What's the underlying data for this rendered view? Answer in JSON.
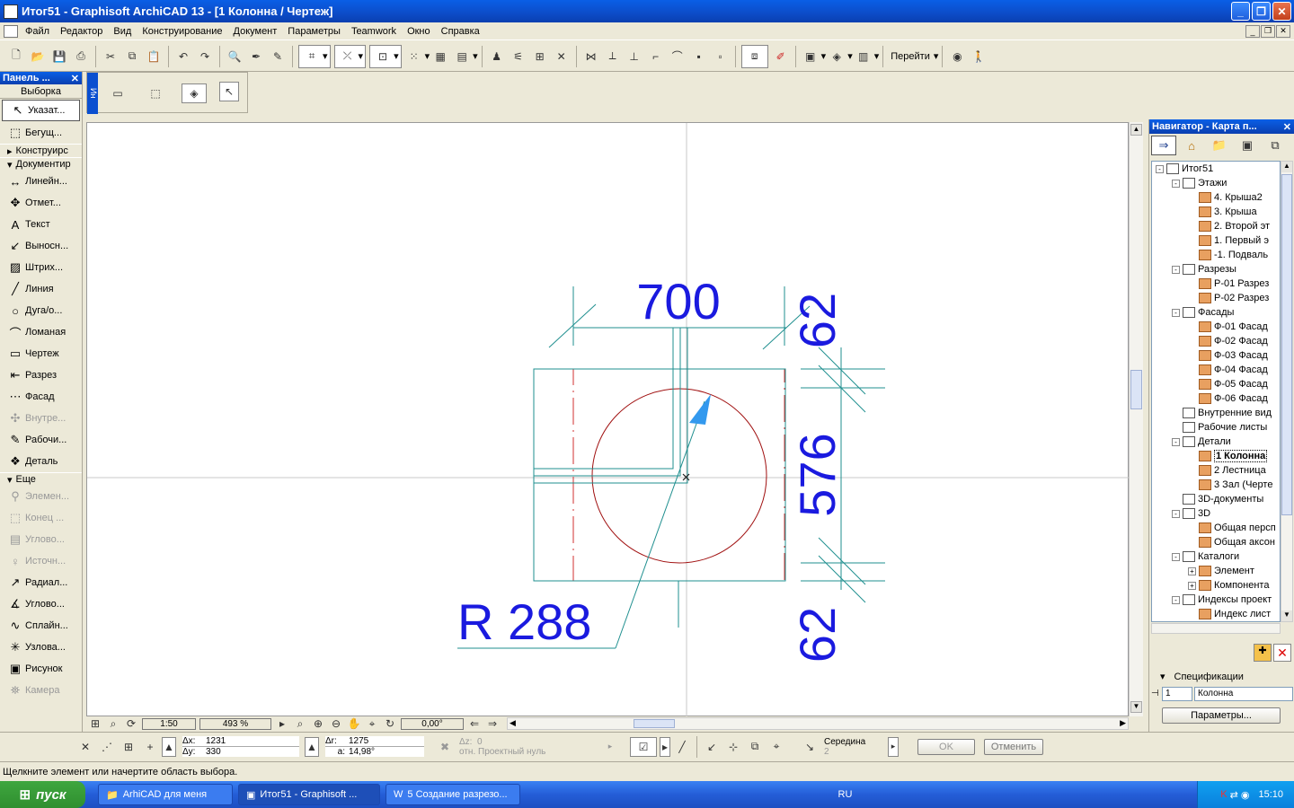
{
  "window": {
    "title": "Итог51 - Graphisoft ArchiCAD 13 - [1 Колонна / Чертеж]"
  },
  "menu": [
    "Файл",
    "Редактор",
    "Вид",
    "Конструирование",
    "Документ",
    "Параметры",
    "Teamwork",
    "Окно",
    "Справка"
  ],
  "toolbar": {
    "goto_label": "Перейти"
  },
  "infobox": {
    "label": "Ин"
  },
  "toolbox": {
    "title": "Панель ...",
    "select_header": "Выборка",
    "select_tools": [
      {
        "label": "Указат...",
        "icon": "arrow-pointer-icon",
        "glyph": "↖"
      },
      {
        "label": "Бегущ...",
        "icon": "marquee-icon",
        "glyph": "⬚"
      }
    ],
    "group_construct": "Конструирс",
    "group_document": "Документир",
    "doc_tools": [
      {
        "label": "Линейн...",
        "icon": "linear-dimension-icon",
        "glyph": "↔",
        "disabled": false
      },
      {
        "label": "Отмет...",
        "icon": "level-dimension-icon",
        "glyph": "✥",
        "disabled": false
      },
      {
        "label": "Текст",
        "icon": "text-icon",
        "glyph": "A",
        "disabled": false
      },
      {
        "label": "Выносн...",
        "icon": "label-icon",
        "glyph": "↙",
        "disabled": false
      },
      {
        "label": "Штрих...",
        "icon": "fill-icon",
        "glyph": "▨",
        "disabled": false
      },
      {
        "label": "Линия",
        "icon": "line-icon",
        "glyph": "╱",
        "disabled": false
      },
      {
        "label": "Дуга/о...",
        "icon": "arc-circle-icon",
        "glyph": "○",
        "disabled": false
      },
      {
        "label": "Ломаная",
        "icon": "polyline-icon",
        "glyph": "⌒",
        "disabled": false
      },
      {
        "label": "Чертеж",
        "icon": "drawing-icon",
        "glyph": "▭",
        "disabled": false
      },
      {
        "label": "Разрез",
        "icon": "section-icon",
        "glyph": "⇤",
        "disabled": false
      },
      {
        "label": "Фасад",
        "icon": "elevation-icon",
        "glyph": "⋯",
        "disabled": false
      },
      {
        "label": "Внутре...",
        "icon": "interior-elevation-icon",
        "glyph": "✣",
        "disabled": true
      },
      {
        "label": "Рабочи...",
        "icon": "worksheet-icon",
        "glyph": "✎",
        "disabled": false
      },
      {
        "label": "Деталь",
        "icon": "detail-icon",
        "glyph": "❖",
        "disabled": false
      }
    ],
    "group_more": "Еще",
    "more_tools": [
      {
        "label": "Элемен...",
        "icon": "element-icon",
        "glyph": "⚲",
        "disabled": true
      },
      {
        "label": "Конец ...",
        "icon": "end-icon",
        "glyph": "⬚",
        "disabled": true
      },
      {
        "label": "Углово...",
        "icon": "corner-icon",
        "glyph": "▤",
        "disabled": true
      },
      {
        "label": "Источн...",
        "icon": "light-source-icon",
        "glyph": "♀",
        "disabled": true
      },
      {
        "label": "Радиал...",
        "icon": "radial-dimension-icon",
        "glyph": "↗",
        "disabled": false
      },
      {
        "label": "Углово...",
        "icon": "angle-dimension-icon",
        "glyph": "∡",
        "disabled": false
      },
      {
        "label": "Сплайн...",
        "icon": "spline-icon",
        "glyph": "∿",
        "disabled": false
      },
      {
        "label": "Узлова...",
        "icon": "hotspot-icon",
        "glyph": "✳",
        "disabled": false
      },
      {
        "label": "Рисунок",
        "icon": "figure-icon",
        "glyph": "▣",
        "disabled": false
      },
      {
        "label": "Камера",
        "icon": "camera-icon",
        "glyph": "⛯",
        "disabled": true
      }
    ]
  },
  "drawing": {
    "dim_top": "700",
    "dim_right_top": "62",
    "dim_right_middle": "576",
    "dim_right_bottom": "62",
    "radius_label": "R 288"
  },
  "viewbar": {
    "scale": "1:50",
    "zoom": "493 %",
    "angle": "0,00°"
  },
  "coords": {
    "dx_label": "Δx:",
    "dx": "1231",
    "dy_label": "Δy:",
    "dy": "330",
    "dr_label": "Δr:",
    "dr": "1275",
    "da_label": "a:",
    "da": "14,98°",
    "dz_label": "Δz:",
    "dz": "0",
    "ref_label": "отн. Проектный нуль",
    "snap_label": "Середина",
    "snap_value": "2",
    "ok": "OK",
    "cancel": "Отменить"
  },
  "status": {
    "text": "Щелкните элемент или начертите область выбора."
  },
  "navigator": {
    "title": "Навигатор - Карта п...",
    "tree": [
      {
        "label": "Итог51",
        "level": 0,
        "exp": "-",
        "icon": "project-icon"
      },
      {
        "label": "Этажи",
        "level": 1,
        "exp": "-",
        "icon": "stories-icon"
      },
      {
        "label": "4. Крыша2",
        "level": 2,
        "exp": "",
        "icon": "story-icon"
      },
      {
        "label": "3. Крыша",
        "level": 2,
        "exp": "",
        "icon": "story-icon"
      },
      {
        "label": "2. Второй эт",
        "level": 2,
        "exp": "",
        "icon": "story-icon"
      },
      {
        "label": "1. Первый э",
        "level": 2,
        "exp": "",
        "icon": "story-icon"
      },
      {
        "label": "-1. Подваль",
        "level": 2,
        "exp": "",
        "icon": "story-icon"
      },
      {
        "label": "Разрезы",
        "level": 1,
        "exp": "-",
        "icon": "sections-icon"
      },
      {
        "label": "Р-01 Разрез",
        "level": 2,
        "exp": "",
        "icon": "section-view-icon"
      },
      {
        "label": "Р-02 Разрез",
        "level": 2,
        "exp": "",
        "icon": "section-view-icon"
      },
      {
        "label": "Фасады",
        "level": 1,
        "exp": "-",
        "icon": "elevations-icon"
      },
      {
        "label": "Ф-01 Фасад",
        "level": 2,
        "exp": "",
        "icon": "elevation-view-icon"
      },
      {
        "label": "Ф-02 Фасад",
        "level": 2,
        "exp": "",
        "icon": "elevation-view-icon"
      },
      {
        "label": "Ф-03 Фасад",
        "level": 2,
        "exp": "",
        "icon": "elevation-view-icon"
      },
      {
        "label": "Ф-04 Фасад",
        "level": 2,
        "exp": "",
        "icon": "elevation-view-icon"
      },
      {
        "label": "Ф-05 Фасад",
        "level": 2,
        "exp": "",
        "icon": "elevation-view-icon"
      },
      {
        "label": "Ф-06 Фасад",
        "level": 2,
        "exp": "",
        "icon": "elevation-view-icon"
      },
      {
        "label": "Внутренние вид",
        "level": 1,
        "exp": "",
        "icon": "interior-elevations-icon"
      },
      {
        "label": "Рабочие листы",
        "level": 1,
        "exp": "",
        "icon": "worksheets-icon"
      },
      {
        "label": "Детали",
        "level": 1,
        "exp": "-",
        "icon": "details-icon"
      },
      {
        "label": "1 Колонна",
        "level": 2,
        "exp": "",
        "icon": "detail-view-icon",
        "selected": true
      },
      {
        "label": "2 Лестница",
        "level": 2,
        "exp": "",
        "icon": "detail-view-icon"
      },
      {
        "label": "3 Зал (Черте",
        "level": 2,
        "exp": "",
        "icon": "detail-view-icon"
      },
      {
        "label": "3D-документы",
        "level": 1,
        "exp": "",
        "icon": "3d-documents-icon"
      },
      {
        "label": "3D",
        "level": 1,
        "exp": "-",
        "icon": "3d-icon"
      },
      {
        "label": "Общая персп",
        "level": 2,
        "exp": "",
        "icon": "perspective-icon"
      },
      {
        "label": "Общая аксон",
        "level": 2,
        "exp": "",
        "icon": "axonometry-icon"
      },
      {
        "label": "Каталоги",
        "level": 1,
        "exp": "-",
        "icon": "schedules-icon"
      },
      {
        "label": "Элемент",
        "level": 2,
        "exp": "+",
        "icon": "element-schedule-icon"
      },
      {
        "label": "Компонента",
        "level": 2,
        "exp": "+",
        "icon": "component-schedule-icon"
      },
      {
        "label": "Индексы проект",
        "level": 1,
        "exp": "-",
        "icon": "project-indexes-icon"
      },
      {
        "label": "Индекс лист",
        "level": 2,
        "exp": "",
        "icon": "sheet-index-icon"
      }
    ],
    "spec_header": "Спецификации",
    "spec_number": "1",
    "spec_name": "Колонна",
    "params_button": "Параметры..."
  },
  "taskbar": {
    "start": "пуск",
    "tasks": [
      "ArhiCAD для меня",
      "Итог51 - Graphisoft ...",
      "5 Создание разрезо..."
    ],
    "lang": "RU",
    "clock": "15:10"
  },
  "colors": {
    "dimension_text": "#1a1adf",
    "dimension_line": "#1f8f8f",
    "circle": "#a01010",
    "title_bar": "#0a5fe6"
  }
}
